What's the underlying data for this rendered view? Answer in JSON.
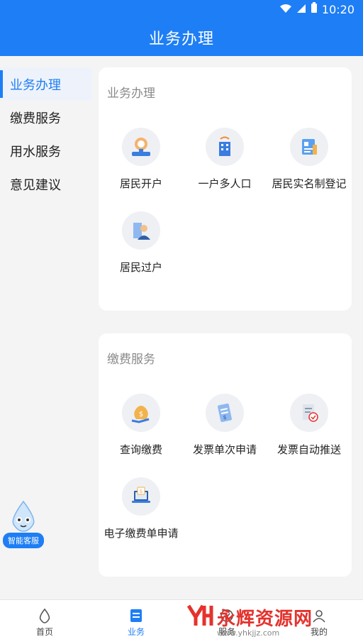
{
  "statusbar": {
    "time": "10:20"
  },
  "appbar": {
    "title": "业务办理"
  },
  "sidebar": {
    "items": [
      {
        "label": "业务办理"
      },
      {
        "label": "缴费服务"
      },
      {
        "label": "用水服务"
      },
      {
        "label": "意见建议"
      }
    ]
  },
  "cards": [
    {
      "title": "业务办理",
      "tiles": [
        {
          "label": "居民开户",
          "icon": "water-meter-icon"
        },
        {
          "label": "一户多人口",
          "icon": "building-icon"
        },
        {
          "label": "居民实名制登记",
          "icon": "id-register-icon"
        },
        {
          "label": "居民过户",
          "icon": "person-transfer-icon"
        }
      ]
    },
    {
      "title": "缴费服务",
      "tiles": [
        {
          "label": "查询缴费",
          "icon": "money-bag-icon"
        },
        {
          "label": "发票单次申请",
          "icon": "invoice-icon"
        },
        {
          "label": "发票自动推送",
          "icon": "invoice-check-icon"
        },
        {
          "label": "电子缴费单申请",
          "icon": "laptop-bill-icon"
        }
      ]
    }
  ],
  "customer_service": {
    "label": "智能客服"
  },
  "tabs": [
    {
      "label": "首页",
      "icon": "water-drop-icon"
    },
    {
      "label": "业务",
      "icon": "document-icon"
    },
    {
      "label": "服务",
      "icon": "service-icon"
    },
    {
      "label": "我的",
      "icon": "user-icon"
    }
  ],
  "watermark": {
    "text": "永辉资源网",
    "url": "www.yhkjjz.com"
  },
  "colors": {
    "primary": "#1e7ef5",
    "background": "#f4f4f4"
  }
}
